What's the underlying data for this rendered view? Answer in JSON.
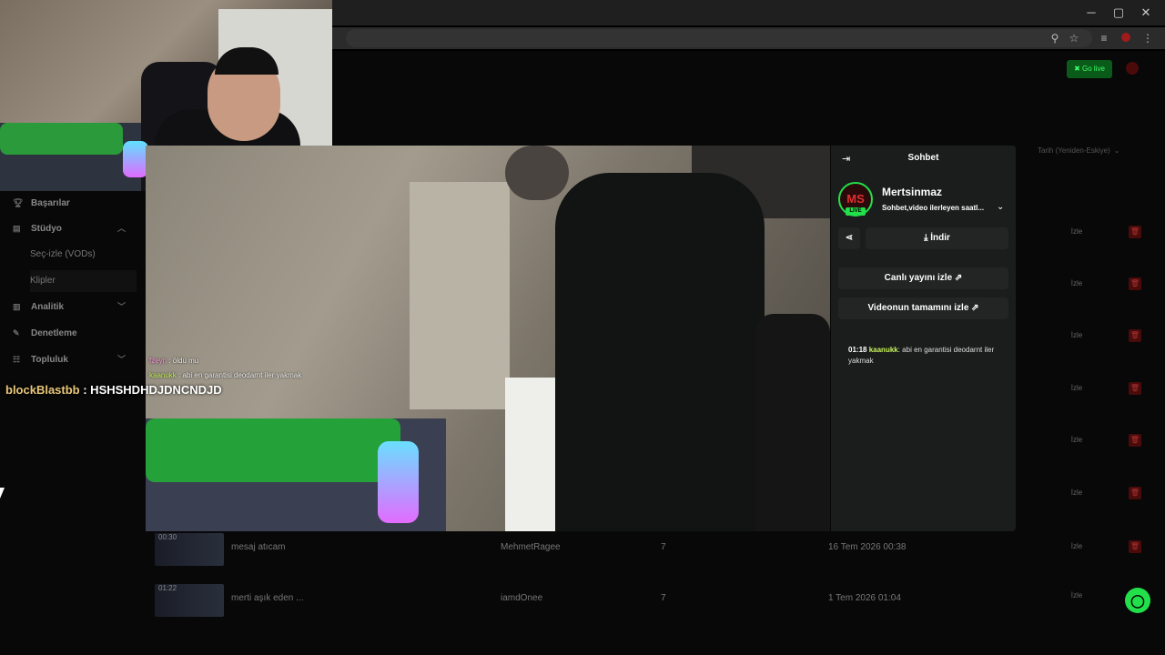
{
  "window": {
    "minimize": "─",
    "maximize": "▢",
    "close": "✕"
  },
  "topbar": {
    "go_live": "Go live"
  },
  "sort": {
    "label": "Tarih (Yeniden-Eskiye)"
  },
  "sidebar": {
    "items": [
      {
        "label": "Başarılar"
      },
      {
        "label": "Stüdyo"
      },
      {
        "label": "Seç-izle (VODs)"
      },
      {
        "label": "Klipler"
      },
      {
        "label": "Analitik"
      },
      {
        "label": "Denetleme"
      },
      {
        "label": "Topluluk"
      }
    ]
  },
  "overlay_chat": [
    {
      "user": "fzeyn",
      "text": " : öldu mu",
      "color": "#ff9adf"
    },
    {
      "user": "kaanukk",
      "text": " : abi en garantisi deodarnt iler yakmak",
      "color": "#c8f55a"
    }
  ],
  "big_chat": {
    "user": "blockBlastbb",
    "text": " : HSHSHDHDJDNCNDJD"
  },
  "chat_panel": {
    "title": "Sohbet",
    "channel": "Mertsinmaz",
    "subtitle": "Sohbet,video ilerleyen saatl...",
    "live_badge": "LIVE",
    "download": "İndir",
    "watch_live": "Canlı yayını izle",
    "watch_full": "Videonun tamamını izle",
    "message": {
      "time": "01:18",
      "user": "kaanukk",
      "text": ": abi en garantisi deodarnt iler yakmak"
    }
  },
  "rows": [
    {
      "watch": "İzle"
    },
    {
      "watch": "İzle"
    },
    {
      "watch": "İzle"
    },
    {
      "watch": "İzle"
    },
    {
      "watch": "İzle"
    },
    {
      "watch": "İzle"
    },
    {
      "duration": "00:30",
      "title": "mesaj atıcam",
      "author": "MehmetRagee",
      "count": "7",
      "date": "16 Tem 2026 00:38",
      "watch": "İzle"
    },
    {
      "duration": "01:22",
      "title": "merti aşık eden ...",
      "author": "iamdOnee",
      "count": "7",
      "date": "1 Tem 2026 01:04",
      "watch": "İzle"
    }
  ],
  "colors": {
    "accent": "#22e04a",
    "panel": "#1b1d1c",
    "username_green": "#c8f55a"
  }
}
